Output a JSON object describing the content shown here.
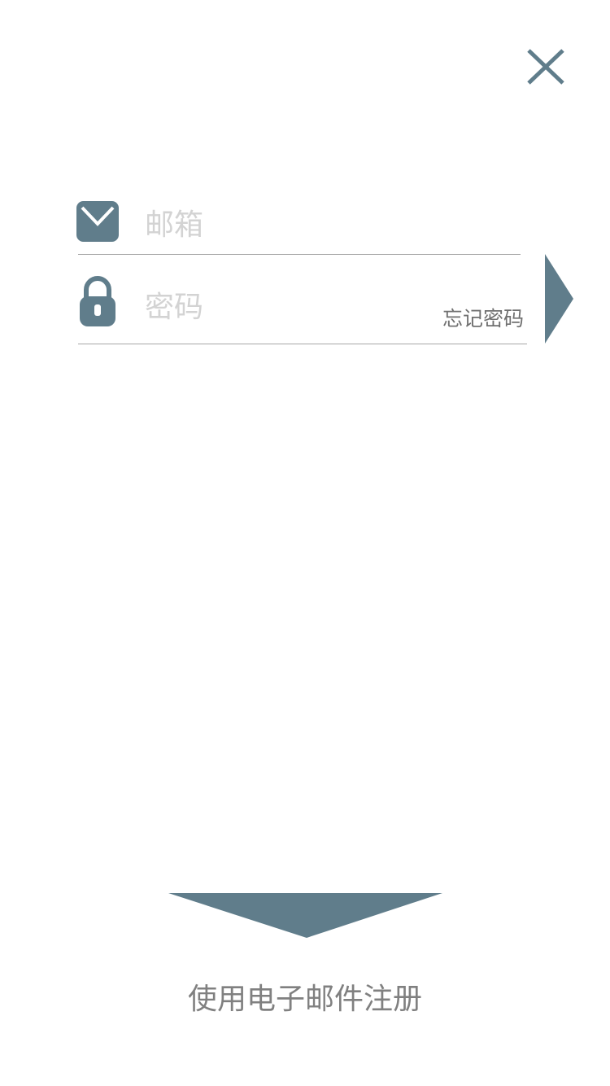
{
  "header": {
    "close_icon": "close-icon"
  },
  "login_form": {
    "email": {
      "icon": "envelope-icon",
      "value": "",
      "placeholder": "邮箱"
    },
    "password": {
      "icon": "lock-icon",
      "value": "",
      "placeholder": "密码"
    },
    "forgot_password_label": "忘记密码",
    "submit_icon": "arrow-right-icon"
  },
  "register": {
    "icon": "arrow-down-icon",
    "label": "使用电子邮件注册"
  },
  "colors": {
    "accent": "#607d8b",
    "divider": "#a6a6a6",
    "placeholder": "#d3d3d3",
    "secondary_text": "#808080"
  }
}
